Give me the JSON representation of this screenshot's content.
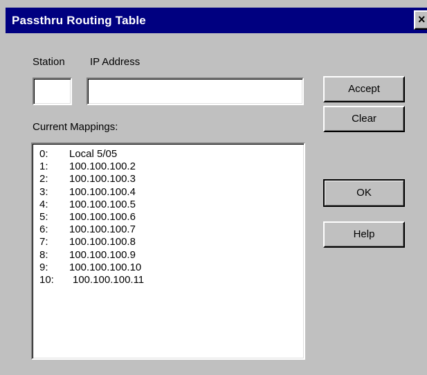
{
  "window": {
    "title": "Passthru Routing Table",
    "close_glyph": "×"
  },
  "labels": {
    "station": "Station",
    "ip_address": "IP Address",
    "current_mappings": "Current Mappings:"
  },
  "inputs": {
    "station_value": "",
    "ip_value": ""
  },
  "mappings": [
    {
      "index": "0:",
      "value": "Local 5/05"
    },
    {
      "index": "1:",
      "value": "100.100.100.2"
    },
    {
      "index": "2:",
      "value": "100.100.100.3"
    },
    {
      "index": "3:",
      "value": "100.100.100.4"
    },
    {
      "index": "4:",
      "value": "100.100.100.5"
    },
    {
      "index": "5:",
      "value": "100.100.100.6"
    },
    {
      "index": "6:",
      "value": "100.100.100.7"
    },
    {
      "index": "7:",
      "value": "100.100.100.8"
    },
    {
      "index": "8:",
      "value": "100.100.100.9"
    },
    {
      "index": "9:",
      "value": "100.100.100.10"
    },
    {
      "index": "10:",
      "value": "100.100.100.11"
    }
  ],
  "buttons": {
    "accept": "Accept",
    "clear": "Clear",
    "ok": "OK",
    "help": "Help"
  },
  "colors": {
    "title_bar": "#000080",
    "face": "#c0c0c0"
  }
}
